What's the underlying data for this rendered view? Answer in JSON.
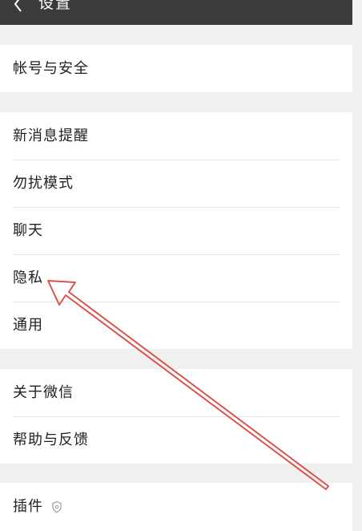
{
  "header": {
    "title": "设置",
    "back_icon": "chevron-left-icon",
    "background": "#3b3b3b"
  },
  "groups": [
    {
      "items": [
        {
          "label": "帐号与安全"
        }
      ]
    },
    {
      "items": [
        {
          "label": "新消息提醒"
        },
        {
          "label": "勿扰模式"
        },
        {
          "label": "聊天"
        },
        {
          "label": "隐私"
        },
        {
          "label": "通用"
        }
      ]
    },
    {
      "items": [
        {
          "label": "关于微信"
        },
        {
          "label": "帮助与反馈"
        }
      ]
    },
    {
      "items": [
        {
          "label": "插件",
          "icon": "plugin-icon"
        }
      ]
    }
  ],
  "annotation": {
    "icon": "red-arrow-icon",
    "color": "#d9534f",
    "points_to": "隐私"
  },
  "colors": {
    "page_background": "#f0f0f0",
    "row_background": "#ffffff",
    "divider": "#e6e6e6"
  }
}
